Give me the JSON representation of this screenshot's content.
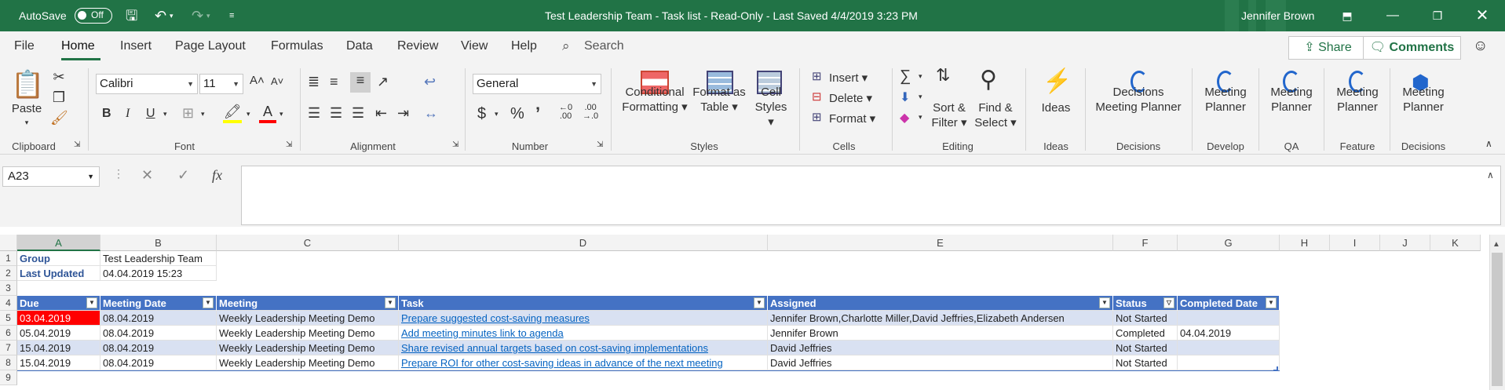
{
  "titlebar": {
    "autosave_label": "AutoSave",
    "autosave_state": "Off",
    "title": "Test Leadership Team - Task list  -  Read-Only  -  Last Saved 4/4/2019 3:23 PM",
    "user": "Jennifer Brown",
    "accent": "#217346"
  },
  "menu": {
    "tabs": [
      "File",
      "Home",
      "Insert",
      "Page Layout",
      "Formulas",
      "Data",
      "Review",
      "View",
      "Help"
    ],
    "active": "Home",
    "search": "Search",
    "share": "Share",
    "comments": "Comments"
  },
  "ribbon": {
    "clipboard": {
      "paste": "Paste",
      "label": "Clipboard"
    },
    "font": {
      "name": "Calibri",
      "size": "11",
      "label": "Font"
    },
    "alignment": {
      "label": "Alignment"
    },
    "number": {
      "format": "General",
      "label": "Number"
    },
    "styles": {
      "conditional": [
        "Conditional",
        "Formatting"
      ],
      "format_table": [
        "Format as",
        "Table"
      ],
      "cell_styles": [
        "Cell",
        "Styles"
      ],
      "label": "Styles"
    },
    "cells": {
      "insert": "Insert",
      "delete": "Delete",
      "format": "Format",
      "label": "Cells"
    },
    "editing": {
      "sort": [
        "Sort &",
        "Filter"
      ],
      "find": [
        "Find &",
        "Select"
      ],
      "label": "Editing"
    },
    "ideas": {
      "button": "Ideas",
      "label": "Ideas"
    },
    "planners": [
      {
        "button": [
          "Decisions",
          "Meeting Planner"
        ],
        "label": "Decisions"
      },
      {
        "button": [
          "Meeting",
          "Planner"
        ],
        "label": "Develop"
      },
      {
        "button": [
          "Meeting",
          "Planner"
        ],
        "label": "QA"
      },
      {
        "button": [
          "Meeting",
          "Planner"
        ],
        "label": "Feature"
      },
      {
        "button": [
          "Meeting",
          "Planner"
        ],
        "label": "Decisions"
      }
    ]
  },
  "formula": {
    "namebox": "A23",
    "fx": "fx",
    "value": ""
  },
  "sheet": {
    "columns": [
      "A",
      "B",
      "C",
      "D",
      "E",
      "F",
      "G",
      "H",
      "I",
      "J",
      "K"
    ],
    "rows": [
      "1",
      "2",
      "3",
      "4",
      "5",
      "6",
      "7",
      "8",
      "9"
    ],
    "info": {
      "group_label": "Group",
      "group_value": "Test Leadership Team",
      "updated_label": "Last Updated",
      "updated_value": "04.04.2019    15:23"
    },
    "table_headers": [
      "Due",
      "Meeting Date",
      "Meeting",
      "Task",
      "Assigned",
      "Status",
      "Completed Date"
    ],
    "table_rows": [
      [
        "03.04.2019",
        "08.04.2019",
        "Weekly Leadership Meeting Demo",
        "Prepare suggested cost-saving measures",
        "Jennifer Brown,Charlotte Miller,David Jeffries,Elizabeth Andersen",
        "Not Started",
        ""
      ],
      [
        "05.04.2019",
        "08.04.2019",
        "Weekly Leadership Meeting Demo",
        "Add meeting minutes link to agenda",
        "Jennifer Brown",
        "Completed",
        "04.04.2019"
      ],
      [
        "15.04.2019",
        "08.04.2019",
        "Weekly Leadership Meeting Demo",
        "Share revised annual targets based on cost-saving implementations",
        "David Jeffries",
        "Not Started",
        ""
      ],
      [
        "15.04.2019",
        "08.04.2019",
        "Weekly Leadership Meeting Demo",
        "Prepare ROI for other cost-saving ideas in advance of the next meeting",
        "David Jeffries",
        "Not Started",
        ""
      ]
    ],
    "colors": {
      "header": "#4472c4",
      "band": "#d9e1f2",
      "overdue": "#ff0000",
      "link": "#0563c1"
    }
  }
}
